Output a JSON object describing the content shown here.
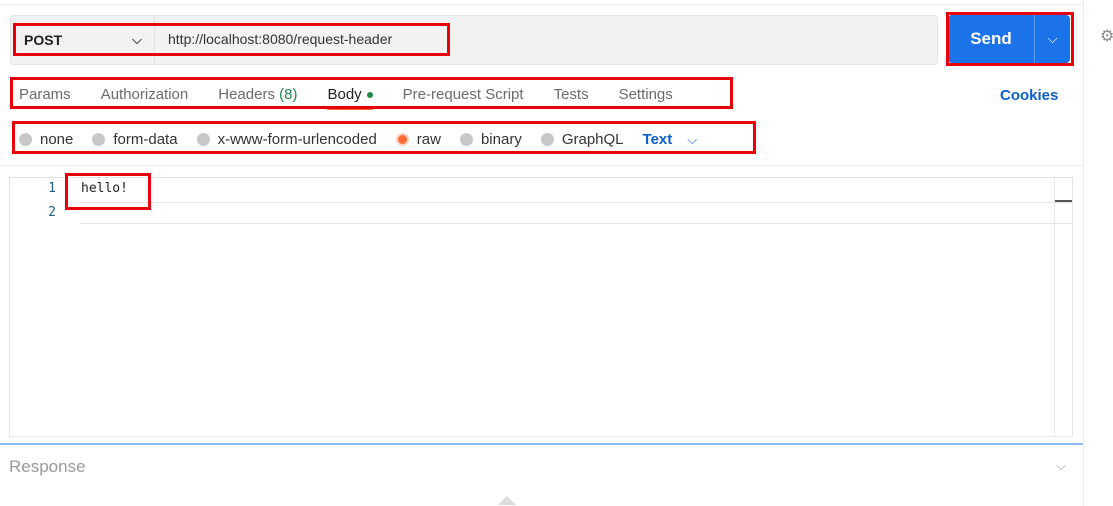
{
  "request": {
    "method": "POST",
    "url": "http://localhost:8080/request-header",
    "send_label": "Send"
  },
  "tabs": [
    {
      "label": "Params"
    },
    {
      "label": "Authorization"
    },
    {
      "label": "Headers",
      "count": "(8)"
    },
    {
      "label": "Body",
      "active": true
    },
    {
      "label": "Pre-request Script"
    },
    {
      "label": "Tests"
    },
    {
      "label": "Settings"
    }
  ],
  "cookies_label": "Cookies",
  "body_types": [
    {
      "label": "none"
    },
    {
      "label": "form-data"
    },
    {
      "label": "x-www-form-urlencoded"
    },
    {
      "label": "raw",
      "selected": true
    },
    {
      "label": "binary"
    },
    {
      "label": "GraphQL"
    }
  ],
  "raw_format": "Text",
  "editor": {
    "lines": [
      {
        "number": "1",
        "text": "hello!"
      },
      {
        "number": "2",
        "text": ""
      }
    ]
  },
  "response": {
    "label": "Response"
  },
  "colors": {
    "accent": "#ff6c37",
    "send_button": "#1a73e8",
    "link": "#0b5fcc",
    "highlight": "#e8000b"
  },
  "icons": [
    "chevron-down-icon",
    "lightbulb-icon",
    "status-dot-icon",
    "collapse-triangle-icon"
  ]
}
